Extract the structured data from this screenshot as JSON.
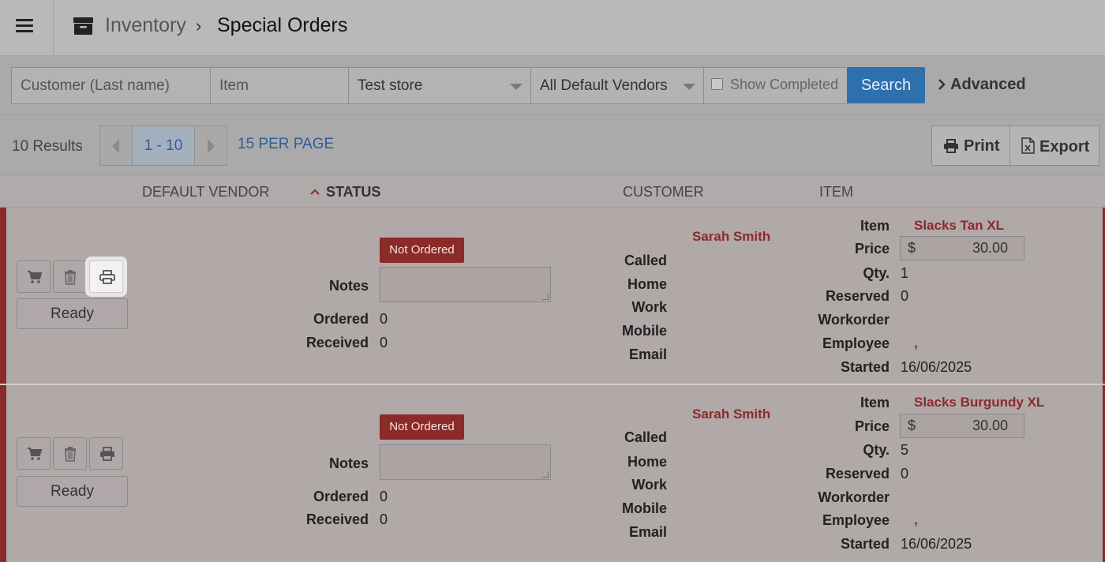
{
  "header": {
    "breadcrumb": {
      "parent": "Inventory",
      "separator": "›",
      "current": "Special Orders"
    },
    "icons": {
      "menu": "hamburger-icon",
      "section": "archive-box-icon"
    }
  },
  "filters": {
    "customer_placeholder": "Customer (Last name)",
    "item_placeholder": "Item",
    "store_value": "Test store",
    "vendor_value": "All Default Vendors",
    "show_completed_label": "Show Completed",
    "show_completed_checked": false,
    "search_label": "Search",
    "advanced_label": "Advanced"
  },
  "results": {
    "count_label": "10 Results",
    "page_range": "1 - 10",
    "per_page_label": "15 PER PAGE",
    "print_label": "Print",
    "export_label": "Export"
  },
  "columns": {
    "vendor": "DEFAULT VENDOR",
    "status": "STATUS",
    "customer": "CUSTOMER",
    "item": "ITEM"
  },
  "labels": {
    "notes": "Notes",
    "ordered": "Ordered",
    "received": "Received",
    "called": "Called",
    "home": "Home",
    "work": "Work",
    "mobile": "Mobile",
    "email": "Email",
    "item": "Item",
    "price": "Price",
    "qty": "Qty.",
    "reserved": "Reserved",
    "workorder": "Workorder",
    "employee": "Employee",
    "started": "Started",
    "ready": "Ready",
    "currency": "$"
  },
  "rows": [
    {
      "status": "Not Ordered",
      "ordered": "0",
      "received": "0",
      "customer": "Sarah Smith",
      "item_name": "Slacks Tan XL",
      "price": "30.00",
      "qty": "1",
      "reserved": "0",
      "employee": ",",
      "started": "16/06/2025"
    },
    {
      "status": "Not Ordered",
      "ordered": "0",
      "received": "0",
      "customer": "Sarah Smith",
      "item_name": "Slacks Burgundy XL",
      "price": "30.00",
      "qty": "5",
      "reserved": "0",
      "employee": ",",
      "started": "16/06/2025"
    }
  ],
  "colors": {
    "accent_red": "#8c2a2a",
    "link_blue": "#2e5f9b",
    "search_blue": "#2e6fae"
  }
}
